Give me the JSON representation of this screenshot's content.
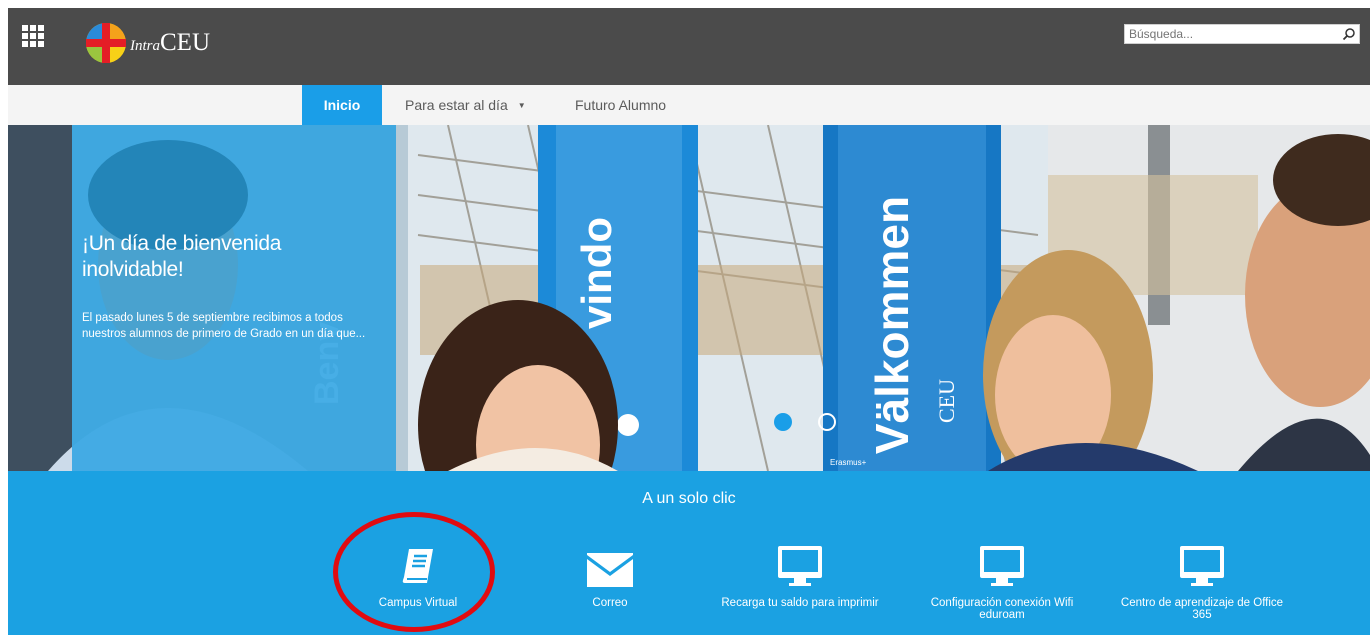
{
  "brand": {
    "logo_intra": "Intra",
    "logo_ceu": "CEU"
  },
  "search": {
    "placeholder": "Búsqueda..."
  },
  "nav": {
    "items": [
      {
        "label": "Inicio"
      },
      {
        "label": "Para estar al día"
      },
      {
        "label": "Futuro Alumno"
      }
    ]
  },
  "hero": {
    "title": "¡Un día de bienvenida inolvidable!",
    "summary": "El pasado lunes 5 de septiembre recibimos a todos nuestros alumnos de primero de Grado en un día que...",
    "banner_texts": [
      "vindo",
      "Välkommen",
      "CEU",
      "Benv",
      "Erasmus+"
    ],
    "slides": {
      "count": 2,
      "active": 1
    }
  },
  "quick_links": {
    "title": "A un solo clic",
    "items": [
      {
        "label": "Campus Virtual",
        "icon": "book-icon"
      },
      {
        "label": "Correo",
        "icon": "envelope-icon"
      },
      {
        "label": "Recarga tu saldo para imprimir",
        "icon": "monitor-icon"
      },
      {
        "label": "Configuración conexión Wifi eduroam",
        "icon": "monitor-icon"
      },
      {
        "label": "Centro de aprendizaje de Office 365",
        "icon": "monitor-icon"
      }
    ]
  },
  "colors": {
    "topbar": "#4b4b4b",
    "accent": "#1ba1e2",
    "nav_bg": "#f4f4f4",
    "highlight": "#e10b10"
  }
}
